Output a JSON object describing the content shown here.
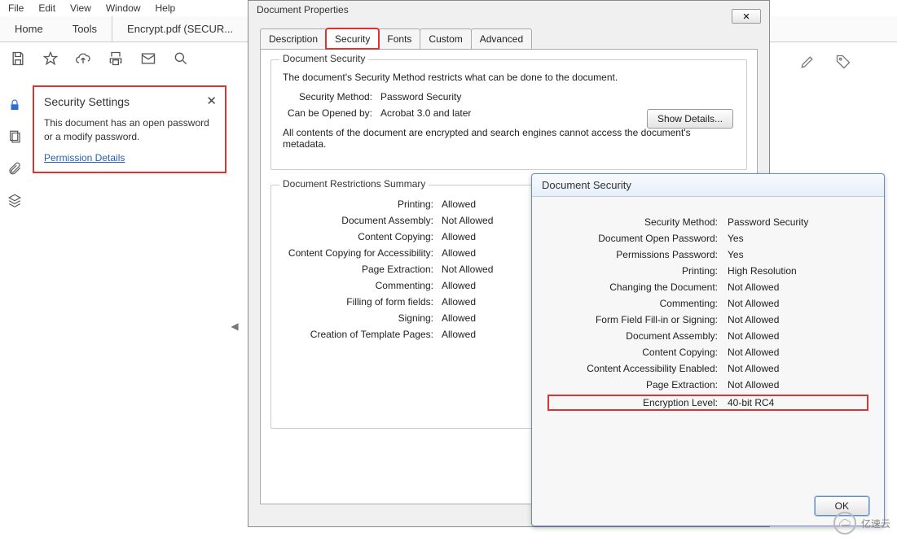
{
  "menubar": {
    "file": "File",
    "edit": "Edit",
    "view": "View",
    "window": "Window",
    "help": "Help"
  },
  "maintabs": {
    "home": "Home",
    "tools": "Tools",
    "doc": "Encrypt.pdf (SECUR..."
  },
  "sec_panel": {
    "title": "Security Settings",
    "body": "This document has an open password or a modify password.",
    "link": "Permission Details"
  },
  "props_dialog": {
    "title": "Document Properties",
    "tabs": {
      "description": "Description",
      "security": "Security",
      "fonts": "Fonts",
      "custom": "Custom",
      "advanced": "Advanced"
    },
    "fs1_legend": "Document Security",
    "desc1": "The document's Security Method restricts what can be done to the document.",
    "method_label": "Security Method:",
    "method_value": "Password Security",
    "show_details": "Show Details...",
    "openby_label": "Can be Opened by:",
    "openby_value": "Acrobat 3.0 and later",
    "desc2": "All contents of the document are encrypted and search engines cannot access the document's metadata.",
    "fs2_legend": "Document Restrictions Summary",
    "restrictions": [
      {
        "label": "Printing:",
        "value": "Allowed"
      },
      {
        "label": "Document Assembly:",
        "value": "Not Allowed"
      },
      {
        "label": "Content Copying:",
        "value": "Allowed"
      },
      {
        "label": "Content Copying for Accessibility:",
        "value": "Allowed"
      },
      {
        "label": "Page Extraction:",
        "value": "Not Allowed"
      },
      {
        "label": "Commenting:",
        "value": "Allowed"
      },
      {
        "label": "Filling of form fields:",
        "value": "Allowed"
      },
      {
        "label": "Signing:",
        "value": "Allowed"
      },
      {
        "label": "Creation of Template Pages:",
        "value": "Allowed"
      }
    ]
  },
  "sec_dialog": {
    "title": "Document Security",
    "rows": [
      {
        "label": "Security Method:",
        "value": "Password Security"
      },
      {
        "label": "Document Open Password:",
        "value": "Yes"
      },
      {
        "label": "Permissions Password:",
        "value": "Yes"
      },
      {
        "label": "Printing:",
        "value": "High Resolution"
      },
      {
        "label": "Changing the Document:",
        "value": "Not Allowed"
      },
      {
        "label": "Commenting:",
        "value": "Not Allowed"
      },
      {
        "label": "Form Field Fill-in or Signing:",
        "value": "Not Allowed"
      },
      {
        "label": "Document Assembly:",
        "value": "Not Allowed"
      },
      {
        "label": "Content Copying:",
        "value": "Not Allowed"
      },
      {
        "label": "Content Accessibility Enabled:",
        "value": "Not Allowed"
      },
      {
        "label": "Page Extraction:",
        "value": "Not Allowed"
      },
      {
        "label": "Encryption Level:",
        "value": "40-bit RC4",
        "highlight": true
      }
    ],
    "ok": "OK"
  },
  "watermark": "亿速云"
}
